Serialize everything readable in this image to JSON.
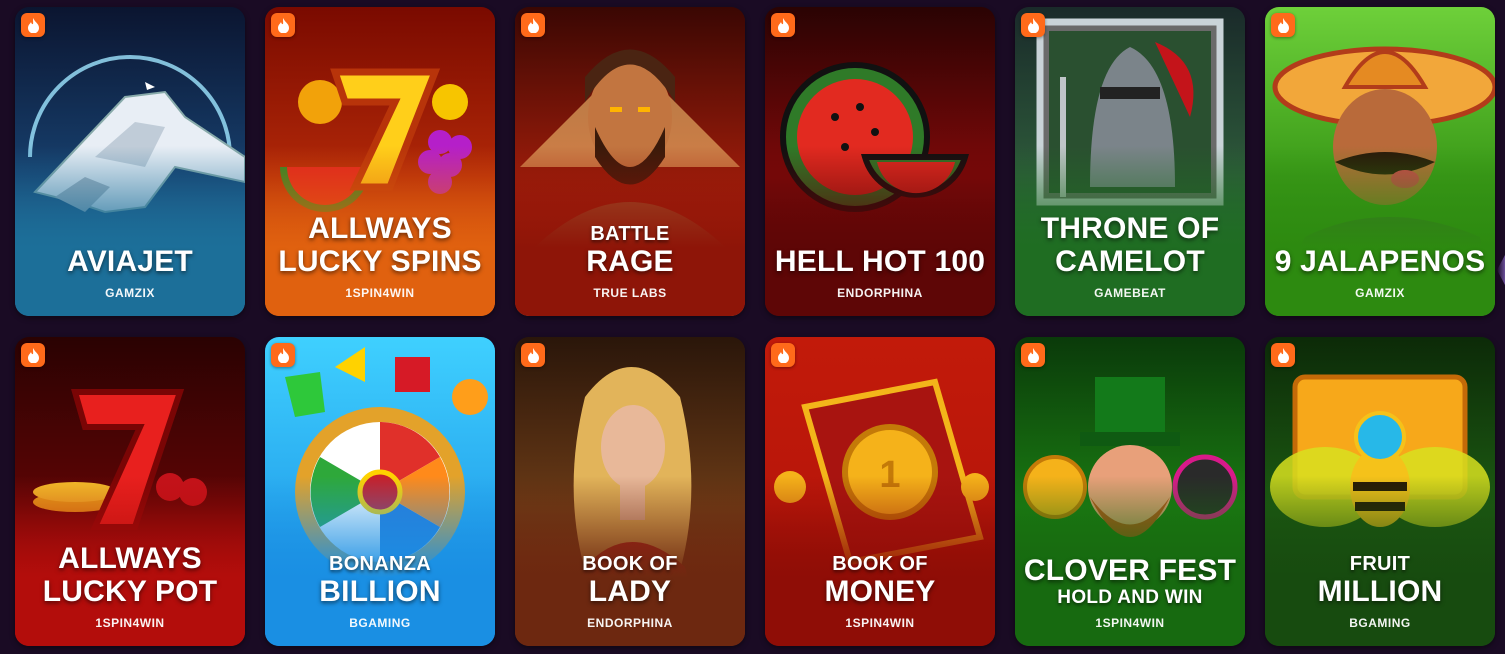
{
  "games": [
    {
      "pre": "",
      "name": "AVIAJET",
      "sub": "",
      "provider": "GAMZIX",
      "hot_icon": "flame-icon",
      "bg": [
        "#0b1530",
        "#17406e",
        "#2b83b0"
      ],
      "fade": "#1c6f99",
      "art": "jet"
    },
    {
      "pre": "",
      "name": "ALLWAYS LUCKY SPINS",
      "sub": "",
      "provider": "1SPIN4WIN",
      "hot_icon": "flame-icon",
      "bg": [
        "#7a0a00",
        "#b12808",
        "#e86a16"
      ],
      "fade": "#e0610f",
      "art": "seven-fruits"
    },
    {
      "pre": "BATTLE",
      "name": "RAGE",
      "sub": "",
      "provider": "TRUE LABS",
      "hot_icon": "flame-icon",
      "bg": [
        "#3a0703",
        "#9a1c0a",
        "#c4210e"
      ],
      "fade": "#8e1508",
      "art": "warrior"
    },
    {
      "pre": "",
      "name": "HELL HOT 100",
      "sub": "",
      "provider": "ENDORPHINA",
      "hot_icon": "flame-icon",
      "bg": [
        "#2a0303",
        "#7e0909",
        "#5a0606"
      ],
      "fade": "#5e0606",
      "art": "watermelon"
    },
    {
      "pre": "",
      "name": "THRONE OF CAMELOT",
      "sub": "",
      "provider": "GAMEBEAT",
      "hot_icon": "flame-icon",
      "bg": [
        "#1a2a2a",
        "#2d5a3a",
        "#1f7a2a"
      ],
      "fade": "#1f6d22",
      "art": "knight"
    },
    {
      "pre": "",
      "name": "9 JALAPENOS",
      "sub": "",
      "provider": "GAMZIX",
      "hot_icon": "flame-icon",
      "bg": [
        "#6ed03a",
        "#3a9a18",
        "#2d8a10"
      ],
      "fade": "#2d8a10",
      "art": "mexican"
    },
    {
      "pre": "",
      "name": "ALLWAYS LUCKY POT",
      "sub": "",
      "provider": "1SPIN4WIN",
      "hot_icon": "flame-icon",
      "bg": [
        "#2a0202",
        "#5e0505",
        "#c2100c"
      ],
      "fade": "#b30d0b",
      "art": "seven-coins"
    },
    {
      "pre": "BONANZA",
      "name": "BILLION",
      "sub": "",
      "provider": "BGAMING",
      "hot_icon": "flame-icon",
      "bg": [
        "#3fd0ff",
        "#28a8ee",
        "#1888e0"
      ],
      "fade": "#1a8fe3",
      "art": "flower"
    },
    {
      "pre": "BOOK OF",
      "name": "LADY",
      "sub": "",
      "provider": "ENDORPHINA",
      "hot_icon": "flame-icon",
      "bg": [
        "#2a160a",
        "#6a3a16",
        "#7a2a10"
      ],
      "fade": "#6d2810",
      "art": "lady"
    },
    {
      "pre": "BOOK OF",
      "name": "MONEY",
      "sub": "",
      "provider": "1SPIN4WIN",
      "hot_icon": "flame-icon",
      "bg": [
        "#c21a0a",
        "#b8160a",
        "#8a0c05"
      ],
      "fade": "#8f0d06",
      "art": "book"
    },
    {
      "pre": "",
      "name": "CLOVER FEST",
      "sub": "HOLD AND WIN",
      "provider": "1SPIN4WIN",
      "hot_icon": "flame-icon",
      "bg": [
        "#0a3a0a",
        "#1a7a12",
        "#15600e"
      ],
      "fade": "#176a10",
      "art": "leprechaun"
    },
    {
      "pre": "FRUIT",
      "name": "MILLION",
      "sub": "",
      "provider": "BGAMING",
      "hot_icon": "flame-icon",
      "bg": [
        "#0c2a08",
        "#1c5a12",
        "#164a0e"
      ],
      "fade": "#174b0f",
      "art": "bee"
    }
  ],
  "carousel": {
    "next_icon": "chevron-right-icon"
  }
}
